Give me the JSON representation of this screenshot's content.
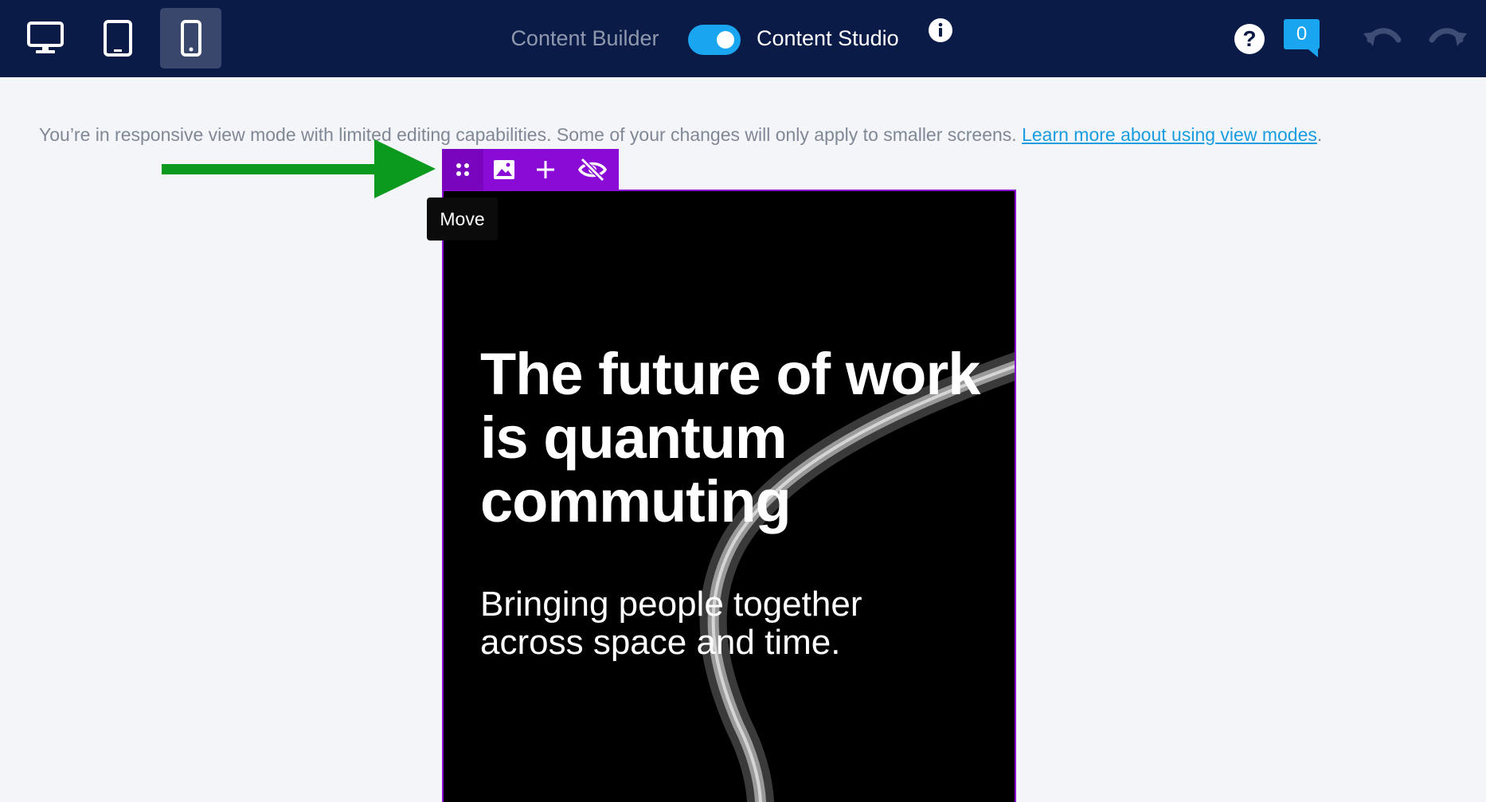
{
  "topbar": {
    "view_modes": [
      {
        "name": "desktop",
        "icon": "desktop-icon",
        "active": false
      },
      {
        "name": "tablet",
        "icon": "tablet-icon",
        "active": false
      },
      {
        "name": "mobile",
        "icon": "mobile-icon",
        "active": true
      }
    ],
    "builder_label": "Content Builder",
    "studio_label": "Content Studio",
    "toggle_on": true,
    "comment_count": "0"
  },
  "notice": {
    "text": "You’re in responsive view mode with limited editing capabilities. Some of your changes will only apply to smaller screens. ",
    "link": "Learn more about using view modes",
    "suffix": "."
  },
  "toolbar": {
    "items": [
      "drag-handle-icon",
      "image-icon",
      "plus-icon",
      "eye-slash-icon"
    ],
    "tooltip": "Move"
  },
  "preview": {
    "headline": "The future of work is quantum commuting",
    "subhead": "Bringing people together across space and time."
  },
  "colors": {
    "topbar_bg": "#0a1b47",
    "accent_blue": "#1aa5f0",
    "toolbar_purple": "#8a0bd6",
    "annotation_green": "#0b9a1e",
    "page_bg": "#f4f5f9"
  }
}
